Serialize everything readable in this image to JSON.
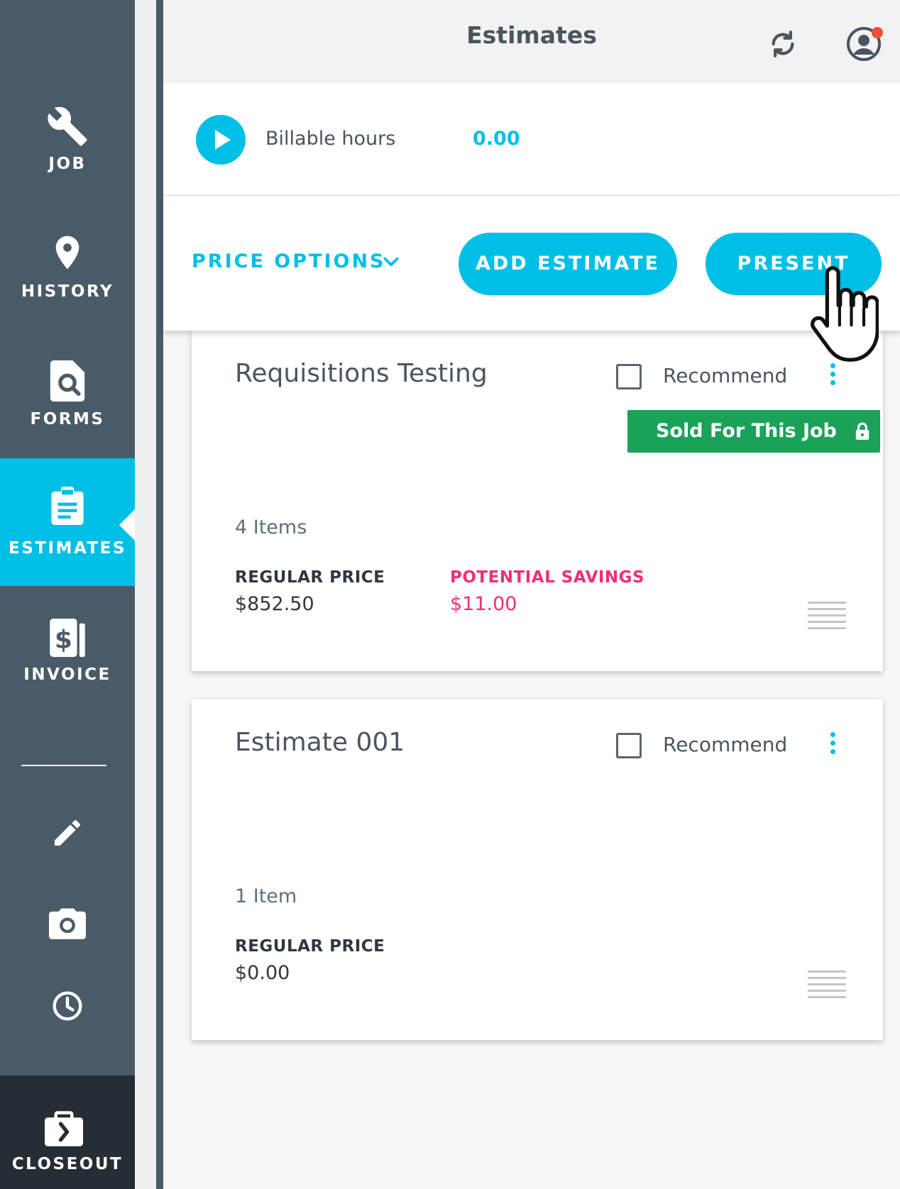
{
  "sidebar": {
    "items": [
      {
        "label": "JOB",
        "icon": "wrench-icon"
      },
      {
        "label": "HISTORY",
        "icon": "location-pin-icon"
      },
      {
        "label": "FORMS",
        "icon": "document-search-icon"
      },
      {
        "label": "ESTIMATES",
        "icon": "clipboard-icon",
        "active": true
      },
      {
        "label": "INVOICE",
        "icon": "invoice-dollar-icon"
      }
    ],
    "tools": [
      "pencil-icon",
      "camera-icon",
      "clock-icon"
    ],
    "closeout": {
      "label": "CLOSEOUT",
      "icon": "briefcase-arrow-icon"
    }
  },
  "header": {
    "title": "Estimates"
  },
  "billable": {
    "label": "Billable hours",
    "value": "0.00"
  },
  "toolbar": {
    "price_options": "PRICE OPTIONS",
    "add_estimate": "ADD ESTIMATE",
    "present": "PRESENT"
  },
  "cards": [
    {
      "title": "Requisitions Testing",
      "recommend": "Recommend",
      "sold_label": "Sold For This Job",
      "items_count": "4 Items",
      "regular_price_label": "REGULAR PRICE",
      "regular_price": "$852.50",
      "savings_label": "POTENTIAL SAVINGS",
      "savings": "$11.00"
    },
    {
      "title": "Estimate 001",
      "recommend": "Recommend",
      "items_count": "1 Item",
      "regular_price_label": "REGULAR PRICE",
      "regular_price": "$0.00"
    }
  ],
  "colors": {
    "accent": "#00bfe6",
    "sidebar": "#4a5b68",
    "sold": "#1aa259",
    "savings": "#ee2f7b",
    "notification": "#f04e37"
  }
}
